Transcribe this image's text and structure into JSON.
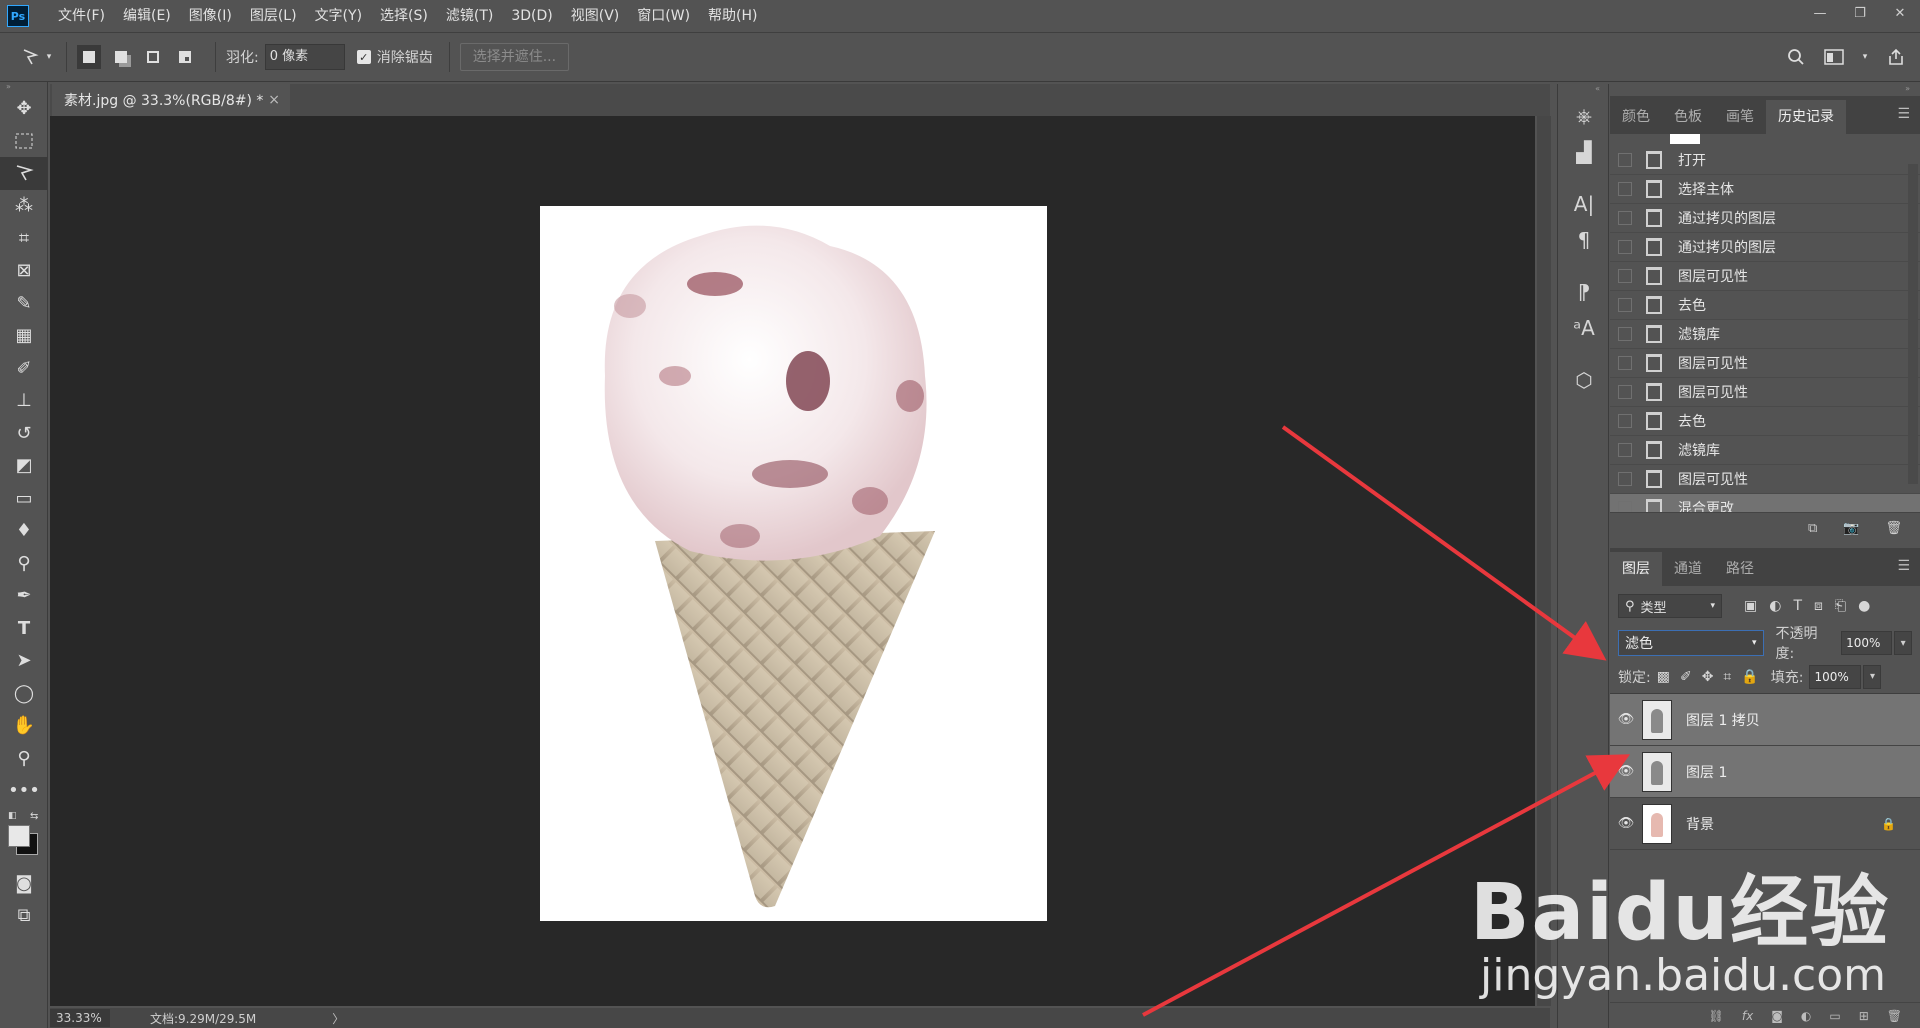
{
  "app": {
    "logo": "Ps"
  },
  "menu": [
    "文件(F)",
    "编辑(E)",
    "图像(I)",
    "图层(L)",
    "文字(Y)",
    "选择(S)",
    "滤镜(T)",
    "3D(D)",
    "视图(V)",
    "窗口(W)",
    "帮助(H)"
  ],
  "window_controls": {
    "minimize": "—",
    "restore": "❐",
    "close": "✕"
  },
  "options_bar": {
    "feather_label": "羽化:",
    "feather_value": "0 像素",
    "antialias_label": "消除锯齿",
    "select_mask_button": "选择并遮住..."
  },
  "document": {
    "tab_title": "素材.jpg @ 33.3%(RGB/8#) *",
    "tab_close": "×",
    "zoom": "33.33%",
    "doc_size": "文档:9.29M/29.5M"
  },
  "history_panel": {
    "tabs": [
      "颜色",
      "色板",
      "画笔",
      "历史记录"
    ],
    "active_tab": 3,
    "items": [
      "打开",
      "选择主体",
      "通过拷贝的图层",
      "通过拷贝的图层",
      "图层可见性",
      "去色",
      "滤镜库",
      "图层可见性",
      "图层可见性",
      "去色",
      "滤镜库",
      "图层可见性",
      "混合更改"
    ],
    "active_item": 12
  },
  "layers_panel": {
    "tabs": [
      "图层",
      "通道",
      "路径"
    ],
    "active_tab": 0,
    "filter_label": "类型",
    "blend_mode": "滤色",
    "opacity_label": "不透明度:",
    "opacity_value": "100%",
    "lock_label": "锁定:",
    "fill_label": "填充:",
    "fill_value": "100%",
    "layers": [
      {
        "name": "图层 1 拷贝",
        "visible": true,
        "active": true
      },
      {
        "name": "图层 1",
        "visible": true,
        "active": true
      },
      {
        "name": "背景",
        "visible": true,
        "active": false,
        "locked": true
      }
    ]
  },
  "watermark": {
    "logo": "Baidu经验",
    "url": "jingyan.baidu.com"
  },
  "colors": {
    "accent_red": "#e8383d",
    "panel_bg": "#535353",
    "canvas_bg": "#282828"
  }
}
